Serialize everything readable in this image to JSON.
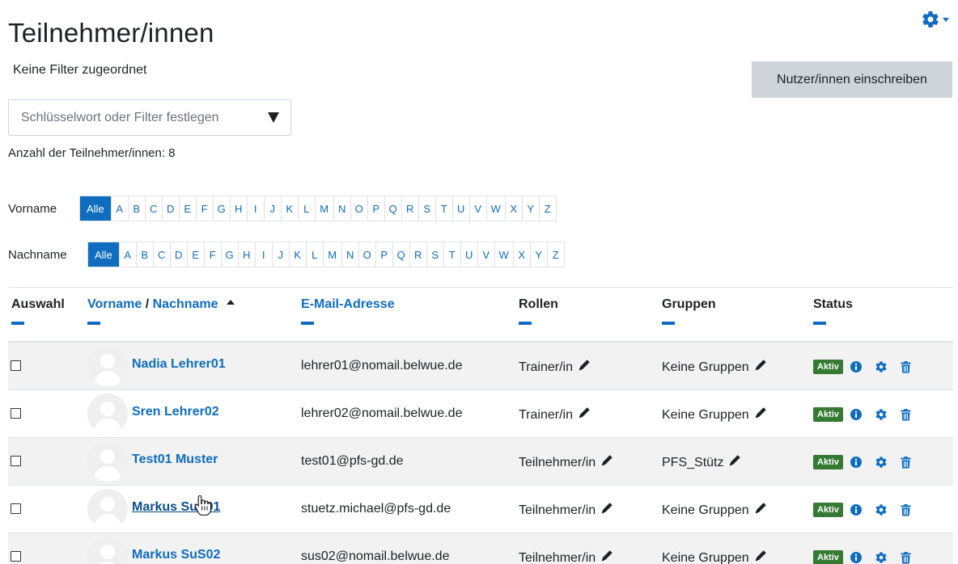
{
  "page": {
    "title": "Teilnehmer/innen",
    "filter_status": "Keine Filter zugeordnet",
    "enrol_button": "Nutzer/innen einschreiben",
    "filter_placeholder": "Schlüsselwort oder Filter festlegen",
    "count": "Anzahl der Teilnehmer/innen: 8"
  },
  "initials": {
    "firstname_label": "Vorname",
    "lastname_label": "Nachname",
    "all_label": "Alle",
    "letters": [
      "A",
      "B",
      "C",
      "D",
      "E",
      "F",
      "G",
      "H",
      "I",
      "J",
      "K",
      "L",
      "M",
      "N",
      "O",
      "P",
      "Q",
      "R",
      "S",
      "T",
      "U",
      "V",
      "W",
      "X",
      "Y",
      "Z"
    ]
  },
  "table": {
    "headers": {
      "select": "Auswahl",
      "firstname": "Vorname",
      "separator": " / ",
      "lastname": "Nachname",
      "email": "E-Mail-Adresse",
      "roles": "Rollen",
      "groups": "Gruppen",
      "status": "Status"
    },
    "rows": [
      {
        "name": "Nadia Lehrer01",
        "email": "lehrer01@nomail.belwue.de",
        "role": "Trainer/in",
        "group": "Keine Gruppen",
        "status": "Aktiv"
      },
      {
        "name": "Sren Lehrer02",
        "email": "lehrer02@nomail.belwue.de",
        "role": "Trainer/in",
        "group": "Keine Gruppen",
        "status": "Aktiv"
      },
      {
        "name": "Test01 Muster",
        "email": "test01@pfs-gd.de",
        "role": "Teilnehmer/in",
        "group": "PFS_Stütz",
        "status": "Aktiv"
      },
      {
        "name": "Markus SuS01",
        "email": "stuetz.michael@pfs-gd.de",
        "role": "Teilnehmer/in",
        "group": "Keine Gruppen",
        "status": "Aktiv"
      },
      {
        "name": "Markus SuS02",
        "email": "sus02@nomail.belwue.de",
        "role": "Teilnehmer/in",
        "group": "Keine Gruppen",
        "status": "Aktiv"
      }
    ]
  },
  "colors": {
    "link": "#0f6cbf",
    "active_badge": "#357a32",
    "button_bg": "#ced4da"
  },
  "icons": [
    "gear-icon",
    "info-icon",
    "cog-icon",
    "trash-icon",
    "pencil-icon",
    "avatar-icon",
    "hand-cursor-icon"
  ]
}
